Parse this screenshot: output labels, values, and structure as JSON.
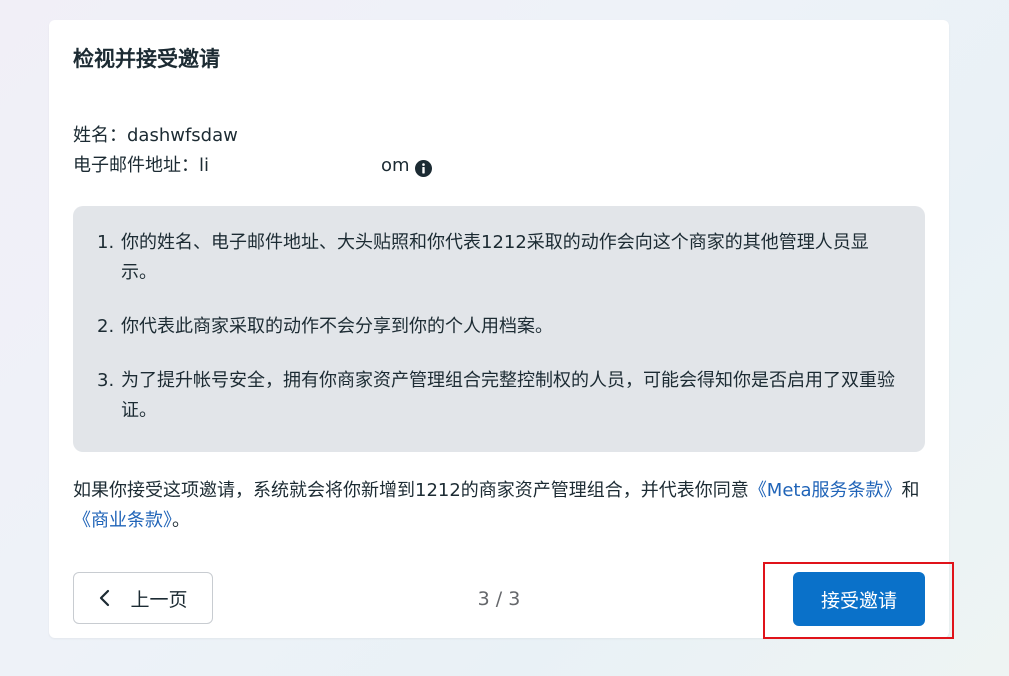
{
  "dialog": {
    "title": "检视并接受邀请",
    "name_label": "姓名：",
    "name_value": "dashwfsdaw",
    "email_label": "电子邮件地址：",
    "email_value_start": "li",
    "email_value_end": "om",
    "email_info_icon": "info-icon"
  },
  "notices": [
    {
      "number": "1.",
      "text": "你的姓名、电子邮件地址、大头贴照和你代表1212采取的动作会向这个商家的其他管理人员显示。"
    },
    {
      "number": "2.",
      "text": "你代表此商家采取的动作不会分享到你的个人用档案。"
    },
    {
      "number": "3.",
      "text": "为了提升帐号安全，拥有你商家资产管理组合完整控制权的人员，可能会得知你是否启用了双重验证。"
    }
  ],
  "consent": {
    "text_before": "如果你接受这项邀请，系统就会将你新增到1212的商家资产管理组合，并代表你同意",
    "meta_terms_link": "《Meta服务条款》",
    "conjunction": "和",
    "business_terms_link": "《商业条款》",
    "end": "。"
  },
  "footer": {
    "prev_label": "上一页",
    "prev_icon": "chevron-left-icon",
    "page_indicator": "3 / 3",
    "accept_label": "接受邀请"
  },
  "colors": {
    "primary_button": "#0a71c9",
    "link": "#2064b8",
    "notice_background": "#e2e5e9",
    "highlight_border": "#e0131a"
  }
}
